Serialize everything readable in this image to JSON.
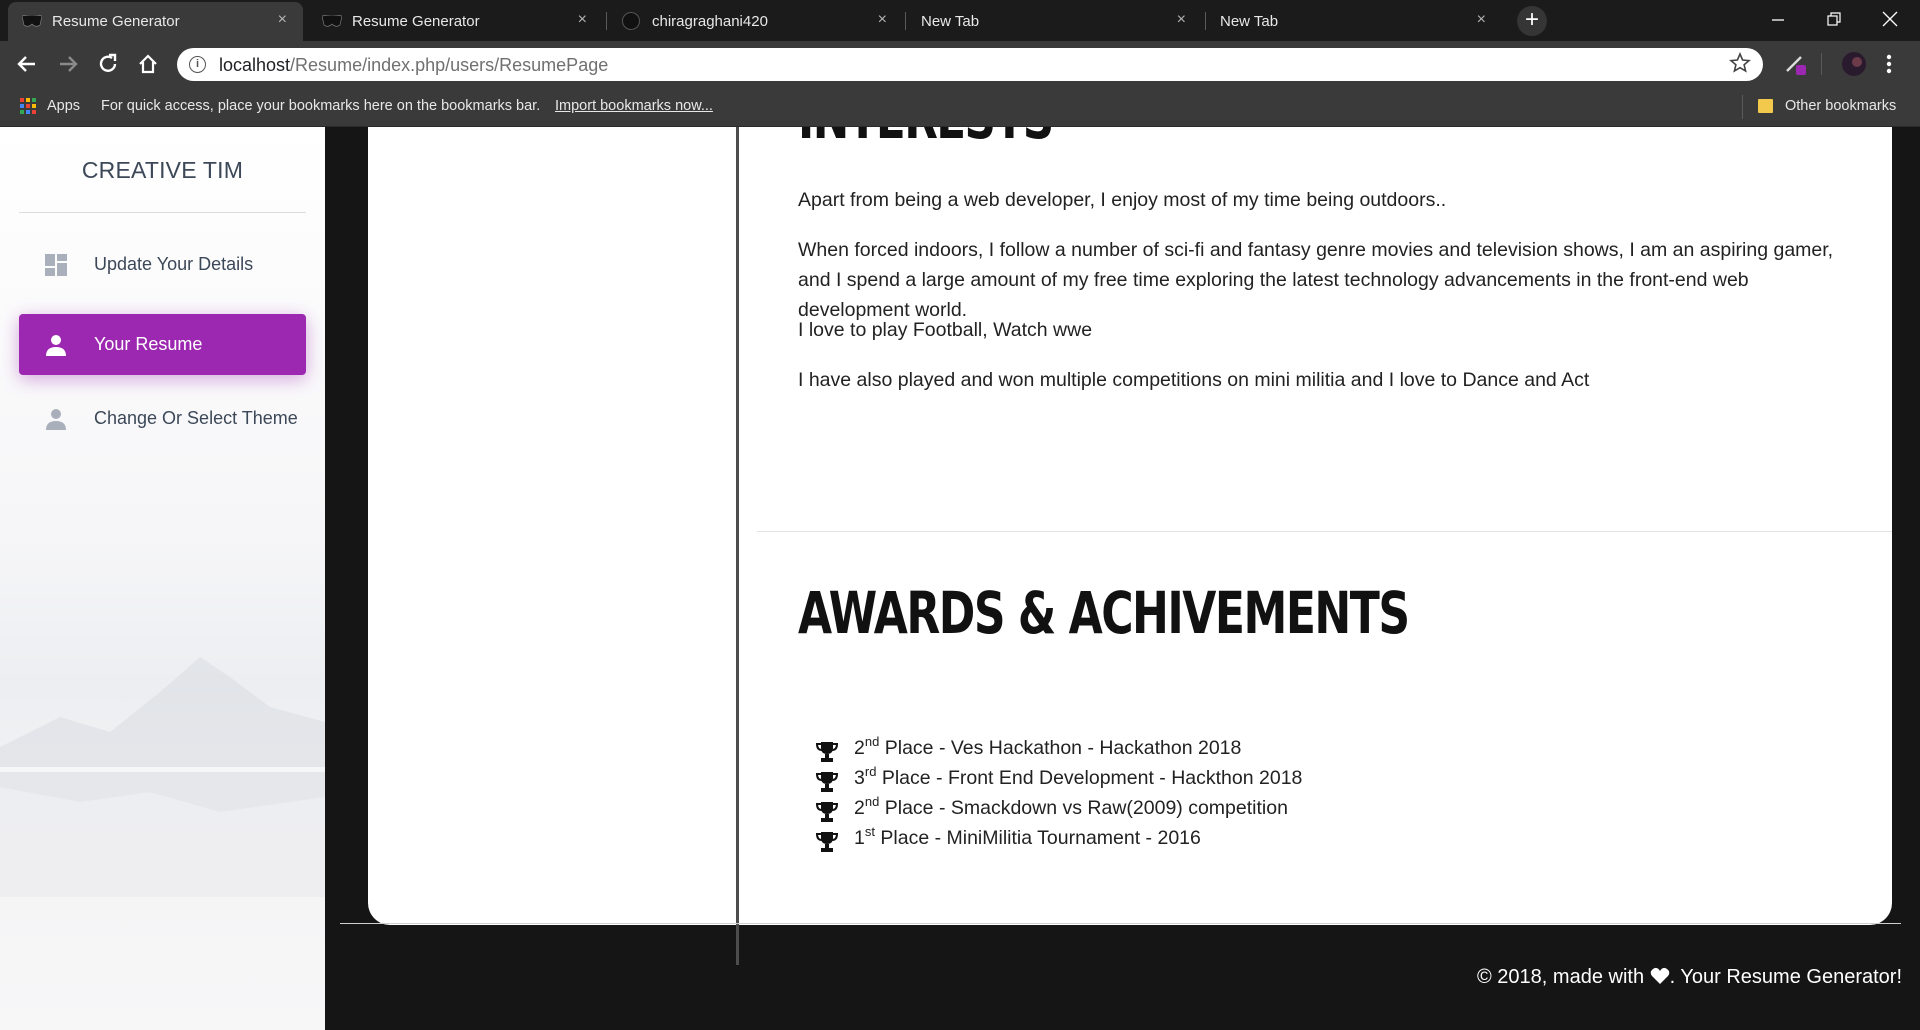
{
  "browser": {
    "tabs": [
      {
        "title": "Resume Generator",
        "active": true
      },
      {
        "title": "Resume Generator",
        "active": false
      },
      {
        "title": "chiragraghani420",
        "active": false
      },
      {
        "title": "New Tab",
        "active": false
      },
      {
        "title": "New Tab",
        "active": false
      }
    ],
    "close_glyph": "×",
    "new_tab_glyph": "+",
    "url_host": "localhost",
    "url_path": "/Resume/index.php/users/ResumePage",
    "bookmarks": {
      "apps_label": "Apps",
      "hint": "For quick access, place your bookmarks here on the bookmarks bar.",
      "import_link": "Import bookmarks now...",
      "other": "Other bookmarks"
    }
  },
  "sidebar": {
    "brand": "CREATIVE TIM",
    "items": [
      {
        "label": "Update Your Details",
        "icon": "dashboard-icon",
        "active": false
      },
      {
        "label": "Your Resume",
        "icon": "person-icon",
        "active": true
      },
      {
        "label": "Change Or Select Theme",
        "icon": "person-icon",
        "active": false
      }
    ],
    "accent": "#9c27b0"
  },
  "resume": {
    "interests_title": "INTERESTS",
    "interests": [
      "Apart from being a web developer, I enjoy most of my time being outdoors..",
      "When forced indoors, I follow a number of sci-fi and fantasy genre movies and television shows, I am an aspiring gamer, and I spend a large amount of my free time exploring the latest technology advancements in the front-end web development world.",
      "I love to play Football, Watch wwe",
      "I have also played and won multiple competitions on mini militia and I love to Dance and Act"
    ],
    "awards_title": "AWARDS & ACHIVEMENTS",
    "awards": [
      {
        "rank": "2",
        "suffix": "nd",
        "text": " Place - Ves Hackathon - Hackathon 2018"
      },
      {
        "rank": "3",
        "suffix": "rd",
        "text": " Place - Front End Development - Hackthon 2018"
      },
      {
        "rank": "2",
        "suffix": "nd",
        "text": " Place - Smackdown vs Raw(2009) competition"
      },
      {
        "rank": "1",
        "suffix": "st",
        "text": " Place - MiniMilitia Tournament - 2016"
      }
    ]
  },
  "footer": {
    "prefix": "© 2018, made with",
    "suffix": ". Your Resume Generator!"
  }
}
